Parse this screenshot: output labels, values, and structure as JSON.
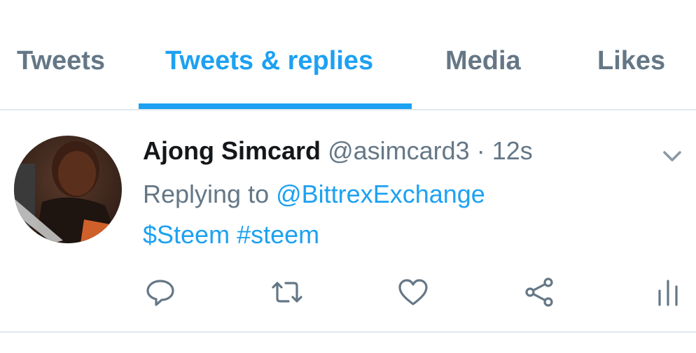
{
  "tabs": [
    {
      "label": "Tweets",
      "active": false
    },
    {
      "label": "Tweets & replies",
      "active": true
    },
    {
      "label": "Media",
      "active": false
    },
    {
      "label": "Likes",
      "active": false
    }
  ],
  "tweet": {
    "display_name": "Ajong Simcard",
    "handle": "@asimcard3",
    "separator": "·",
    "time": "12s",
    "reply_prefix": "Replying to",
    "reply_to": "@BittrexExchange",
    "cashtag": "$Steem",
    "hashtag": "#steem",
    "avatar_icon": "user-avatar-photo",
    "caret_icon": "chevron-down-icon",
    "actions": [
      {
        "name": "reply",
        "icon": "reply-icon"
      },
      {
        "name": "retweet",
        "icon": "retweet-icon"
      },
      {
        "name": "like",
        "icon": "heart-icon"
      },
      {
        "name": "share",
        "icon": "share-icon"
      },
      {
        "name": "analytics",
        "icon": "analytics-icon"
      }
    ]
  },
  "colors": {
    "accent": "#1da1f2",
    "muted": "#657786",
    "text": "#14171a",
    "divider": "#e1e8ed"
  }
}
